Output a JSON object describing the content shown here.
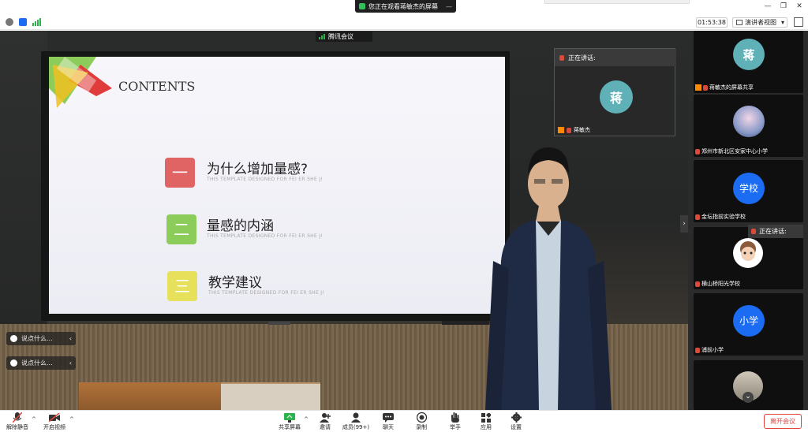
{
  "window": {
    "banner_text": "您正在观看蒋敏杰的屏幕",
    "minimize_glyph": "—",
    "controls": {
      "minimize": "—",
      "restore": "❐",
      "close": "✕"
    }
  },
  "info_bar": {
    "timer": "01:53:38",
    "view_label": "演讲者视图",
    "view_caret": "▾"
  },
  "meeting_tag": "腾讯会议",
  "slide": {
    "heading": "CONTENTS",
    "items": [
      {
        "num": "一",
        "title": "为什么增加量感?",
        "sub": "THIS TEMPLATE DESIGNED FOR FEI ER SHE JI",
        "color": "#e06464"
      },
      {
        "num": "二",
        "title": "量感的内涵",
        "sub": "THIS TEMPLATE DESIGNED FOR FEI ER SHE JI",
        "color": "#8ccc5a"
      },
      {
        "num": "三",
        "title": "教学建议",
        "sub": "THIS TEMPLATE DESIGNED FOR FEI ER SHE JI",
        "color": "#e6e05a"
      }
    ]
  },
  "comments": [
    {
      "text": "说点什么...",
      "chevron": "‹"
    },
    {
      "text": "说点什么...",
      "chevron": "‹"
    }
  ],
  "speaker_tile": {
    "speaking_label": "正在讲话:",
    "avatar_text": "蒋",
    "name": "蒋敏杰"
  },
  "participants": [
    {
      "label": "蒋敏杰的屏幕共享",
      "avatar_type": "image",
      "avatar_text": "蒋"
    },
    {
      "label": "郑州市新北区安家中心小学",
      "avatar_type": "image",
      "avatar_text": ""
    },
    {
      "label": "金坛指前实验学校",
      "avatar_type": "blue",
      "avatar_text": "学校"
    },
    {
      "label": "横山桥阳光学校",
      "avatar_type": "image",
      "avatar_text": ""
    },
    {
      "label": "浦前小学",
      "avatar_type": "blue",
      "avatar_text": "小学"
    },
    {
      "label": "",
      "avatar_type": "image",
      "avatar_text": ""
    }
  ],
  "right_panel": {
    "speaking_label": "正在讲话:",
    "toggle": "›",
    "scroll_down": "⌄"
  },
  "toolbar": {
    "mute": "解除静音",
    "video": "开启视频",
    "share": "共享屏幕",
    "invite": "邀请",
    "members": "成员(99+)",
    "chat": "聊天",
    "record": "录制",
    "raise_hand": "举手",
    "apps": "应用",
    "settings": "设置",
    "leave": "离开会议",
    "caret": "^"
  },
  "colors": {
    "accent_blue": "#1b6cf2",
    "leave_red": "#e2453c",
    "share_green": "#2bb44c"
  }
}
